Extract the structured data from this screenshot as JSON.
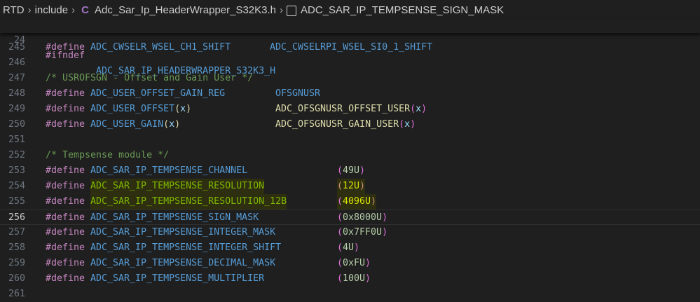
{
  "breadcrumb": [
    "RTD",
    "include",
    "Adc_Sar_Ip_HeaderWrapper_S32K3.h",
    "ADC_SAR_IP_TEMPSENSE_SIGN_MASK"
  ],
  "sticky": {
    "line": "24",
    "keyword": "#ifndef",
    "name": "ADC_SAR_IP_HEADERWRAPPER_S32K3_H"
  },
  "lines": [
    {
      "n": "245",
      "kw": "#define",
      "name": "ADC_CWSELR_WSEL_CH1_SHIFT",
      "val": "ADC_CWSELRPI_WSEL_SI0_1_SHIFT"
    },
    {
      "n": "246"
    },
    {
      "n": "247",
      "comment": "/* USROFSGN - Offset and Gain User */"
    },
    {
      "n": "248",
      "kw": "#define",
      "name": "ADC_USER_OFFSET_GAIN_REG",
      "val": "OFSGNUSR"
    },
    {
      "n": "249",
      "kw": "#define",
      "name": "ADC_USER_OFFSET",
      "arg": "x",
      "val": "ADC_OFSGNUSR_OFFSET_USER",
      "varg": "x"
    },
    {
      "n": "250",
      "kw": "#define",
      "name": "ADC_USER_GAIN",
      "arg": "x",
      "val": "ADC_OFSGNUSR_GAIN_USER",
      "varg": "x"
    },
    {
      "n": "251"
    },
    {
      "n": "252",
      "comment": "/* Tempsense module */"
    },
    {
      "n": "253",
      "kw": "#define",
      "name": "ADC_SAR_IP_TEMPSENSE_CHANNEL",
      "num": "49U"
    },
    {
      "n": "254",
      "kw": "#define",
      "name": "ADC_SAR_IP_TEMPSENSE_RESOLUTION",
      "num": "12U"
    },
    {
      "n": "255",
      "kw": "#define",
      "name": "ADC_SAR_IP_TEMPSENSE_RESOLUTION_12B",
      "num": "4096U"
    },
    {
      "n": "256",
      "kw": "#define",
      "name": "ADC_SAR_IP_TEMPSENSE_SIGN_MASK",
      "num": "0x8000U"
    },
    {
      "n": "257",
      "kw": "#define",
      "name": "ADC_SAR_IP_TEMPSENSE_INTEGER_MASK",
      "num": "0x7FF0U"
    },
    {
      "n": "258",
      "kw": "#define",
      "name": "ADC_SAR_IP_TEMPSENSE_INTEGER_SHIFT",
      "num": "4U"
    },
    {
      "n": "259",
      "kw": "#define",
      "name": "ADC_SAR_IP_TEMPSENSE_DECIMAL_MASK",
      "num": "0xFU"
    },
    {
      "n": "260",
      "kw": "#define",
      "name": "ADC_SAR_IP_TEMPSENSE_MULTIPLIER",
      "num": "100U"
    },
    {
      "n": "261"
    }
  ]
}
